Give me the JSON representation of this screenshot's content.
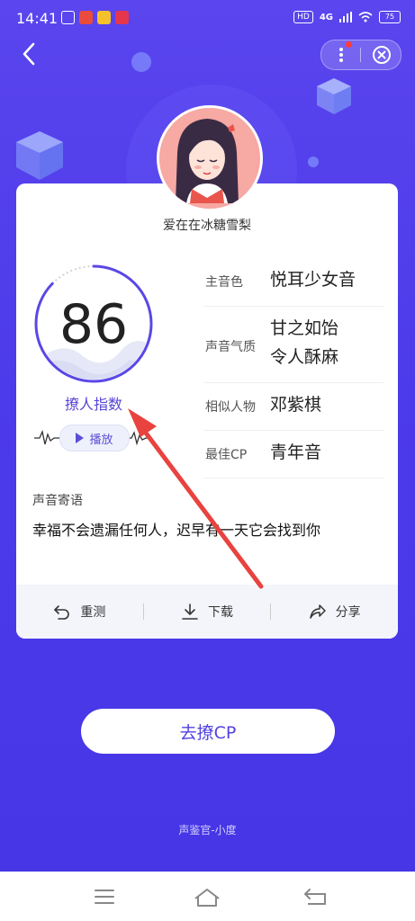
{
  "status_bar": {
    "time": "14:41",
    "hd": "HD",
    "network": "4G",
    "battery": "75"
  },
  "header": {
    "back_icon": "chevron-left-icon",
    "more_icon": "more-vertical-icon",
    "close_icon": "close-circle-icon"
  },
  "profile": {
    "username": "爱在在冰糖雪梨",
    "score": "86",
    "score_label": "撩人指数",
    "play_label": "播放"
  },
  "attributes": [
    {
      "key": "主音色",
      "value": [
        "悦耳少女音"
      ]
    },
    {
      "key": "声音气质",
      "value": [
        "甘之如饴",
        "令人酥麻"
      ]
    },
    {
      "key": "相似人物",
      "value": [
        "邓紫棋"
      ]
    },
    {
      "key": "最佳CP",
      "value": [
        "青年音"
      ]
    }
  ],
  "message": {
    "title": "声音寄语",
    "text": "幸福不会遗漏任何人，迟早有一天它会找到你"
  },
  "actions": [
    {
      "label": "重测",
      "icon": "undo-icon"
    },
    {
      "label": "下载",
      "icon": "download-icon"
    },
    {
      "label": "分享",
      "icon": "share-icon"
    }
  ],
  "cta": {
    "label": "去撩CP"
  },
  "footer": {
    "text": "声鉴官-小度"
  },
  "colors": {
    "background": "#4c3bea",
    "accent": "#5746d6",
    "card": "#ffffff",
    "arrow": "#e8433f"
  }
}
